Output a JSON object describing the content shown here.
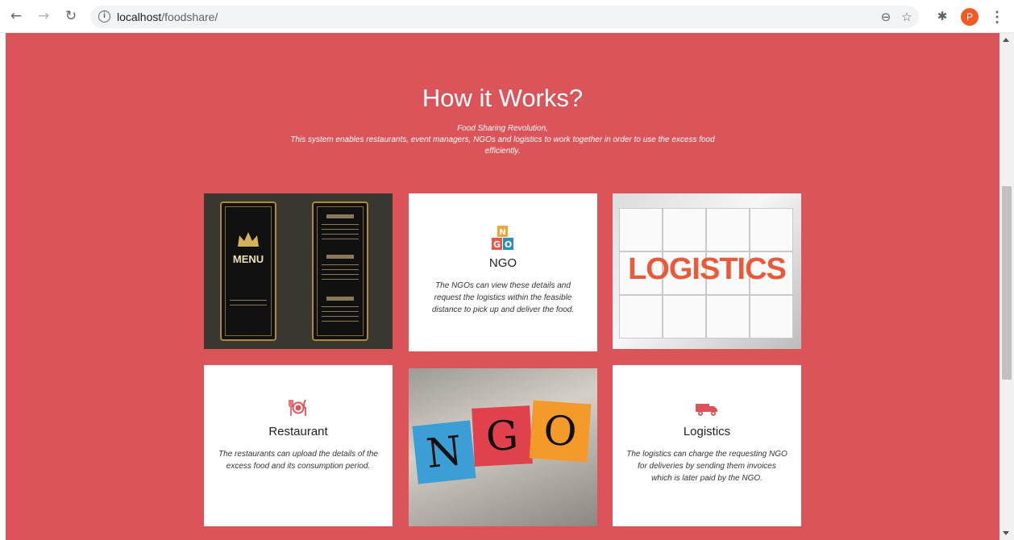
{
  "browser": {
    "url_host": "localhost",
    "url_path": "/foodshare/",
    "avatar_letter": "P",
    "icons": [
      "back-arrow-icon",
      "forward-arrow-icon",
      "reload-icon",
      "info-icon",
      "zoom-icon",
      "star-icon",
      "extensions-icon",
      "menu-icon"
    ]
  },
  "section": {
    "title": "How it Works?",
    "subtitle_line1": "Food Sharing Revolution,",
    "subtitle_line2": "This system enables restaurants, event managers, NGOs and logistics to work together in order to use the excess food",
    "subtitle_line3": "efficiently.",
    "background": "#db5459"
  },
  "cards": {
    "ngo": {
      "title": "NGO",
      "text": "The NGOs can view these details and request the logistics within the feasible distance to pick up and deliver the food.",
      "icon_letters": [
        "N",
        "G",
        "O"
      ]
    },
    "restaurant": {
      "title": "Restaurant",
      "text": "The restaurants can upload the details of the excess food and its consumption period."
    },
    "logistics": {
      "title": "Logistics",
      "text": "The logistics can charge the requesting NGO for deliveries by sending them invoices which is later paid by the NGO."
    }
  },
  "images": {
    "menu_word": "MENU",
    "logistics_word": "LOGISTICS",
    "ngo_blocks": [
      "N",
      "G",
      "O"
    ]
  }
}
